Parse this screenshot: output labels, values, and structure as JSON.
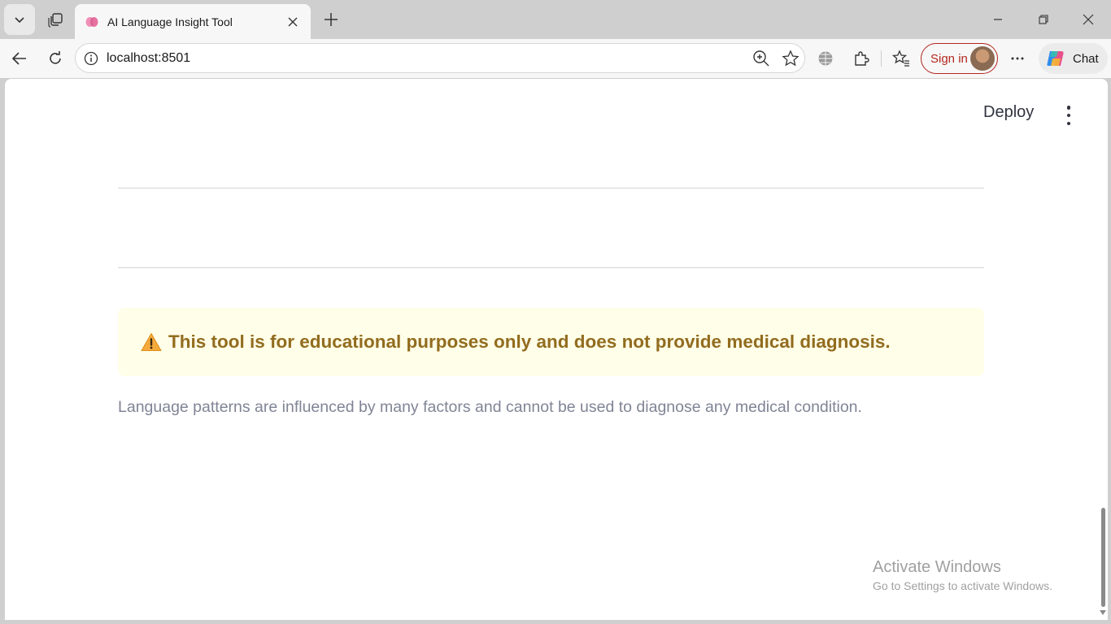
{
  "browser": {
    "tab": {
      "title": "AI Language Insight Tool",
      "favicon": "brain-icon"
    },
    "address_bar": {
      "url": "localhost:8501"
    },
    "sign_in_label": "Sign in",
    "chat_label": "Chat"
  },
  "app": {
    "deploy_label": "Deploy",
    "warning": {
      "icon": "warning-icon",
      "text": "This tool is for educational purposes only and does not provide medical diagnosis."
    },
    "caption": "Language patterns are influenced by many factors and cannot be used to diagnose any medical condition."
  },
  "watermark": {
    "title": "Activate Windows",
    "subtitle": "Go to Settings to activate Windows."
  },
  "colors": {
    "warning_bg": "#fffee8",
    "warning_text": "#926c1f",
    "caption_text": "#808495",
    "signin_accent": "#b3261e"
  }
}
